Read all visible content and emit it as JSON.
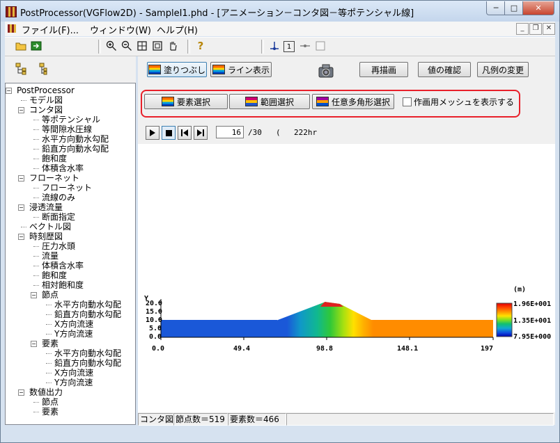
{
  "window": {
    "title": "PostProcessor(VGFlow2D) - SampleI1.phd - [アニメーション－コンタ図－等ポテンシャル線]",
    "min_label": "─",
    "max_label": "□",
    "close_label": "✕"
  },
  "menu": {
    "file": "ファイル(F)...",
    "window": "ウィンドウ(W)",
    "help": "ヘルプ(H)",
    "mdi_min": "_",
    "mdi_restore": "❐",
    "mdi_close": "✕"
  },
  "toolbar": {
    "frame_value": "1"
  },
  "view_tabs": {
    "fill": "塗りつぶし",
    "line": "ライン表示"
  },
  "actions": {
    "redraw": "再描画",
    "check_value": "値の確認",
    "change_legend": "凡例の変更"
  },
  "selection": {
    "element": "要素選択",
    "range": "範囲選択",
    "polygon": "任意多角形選択",
    "show_mesh": "作画用メッシュを表示する"
  },
  "animation": {
    "current_frame": "16",
    "total_frames": "/30",
    "time_open": "(",
    "time_value": "222hr"
  },
  "tree": [
    {
      "label": "PostProcessor",
      "level": 0,
      "toggle": "−"
    },
    {
      "label": "モデル図",
      "level": 1
    },
    {
      "label": "コンタ図",
      "level": 1,
      "toggle": "−"
    },
    {
      "label": "等ポテンシャル",
      "level": 2
    },
    {
      "label": "等間隙水圧線",
      "level": 2
    },
    {
      "label": "水平方向動水勾配",
      "level": 2
    },
    {
      "label": "鉛直方向動水勾配",
      "level": 2
    },
    {
      "label": "飽和度",
      "level": 2
    },
    {
      "label": "体積含水率",
      "level": 2
    },
    {
      "label": "フローネット",
      "level": 1,
      "toggle": "−"
    },
    {
      "label": "フローネット",
      "level": 2
    },
    {
      "label": "流線のみ",
      "level": 2
    },
    {
      "label": "浸透流量",
      "level": 1,
      "toggle": "−"
    },
    {
      "label": "断面指定",
      "level": 2
    },
    {
      "label": "ベクトル図",
      "level": 1
    },
    {
      "label": "時刻歴図",
      "level": 1,
      "toggle": "−"
    },
    {
      "label": "圧力水頭",
      "level": 2
    },
    {
      "label": "流量",
      "level": 2
    },
    {
      "label": "体積含水率",
      "level": 2
    },
    {
      "label": "飽和度",
      "level": 2
    },
    {
      "label": "相対飽和度",
      "level": 2
    },
    {
      "label": "節点",
      "level": 2,
      "toggle": "−"
    },
    {
      "label": "水平方向動水勾配",
      "level": 3
    },
    {
      "label": "鉛直方向動水勾配",
      "level": 3
    },
    {
      "label": "X方向流速",
      "level": 3
    },
    {
      "label": "Y方向流速",
      "level": 3
    },
    {
      "label": "要素",
      "level": 2,
      "toggle": "−"
    },
    {
      "label": "水平方向動水勾配",
      "level": 3
    },
    {
      "label": "鉛直方向動水勾配",
      "level": 3
    },
    {
      "label": "X方向流速",
      "level": 3
    },
    {
      "label": "Y方向流速",
      "level": 3
    },
    {
      "label": "数値出力",
      "level": 1,
      "toggle": "−"
    },
    {
      "label": "節点",
      "level": 2
    },
    {
      "label": "要素",
      "level": 2
    }
  ],
  "plot": {
    "y_axis_label": "Y",
    "y_ticks": [
      "20.0",
      "15.0",
      "10.0",
      "5.0",
      "0.0"
    ],
    "x_ticks": [
      "0.0",
      "49.4",
      "98.8",
      "148.1",
      "197"
    ],
    "legend_unit": "(m)",
    "legend_max": "1.96E+001",
    "legend_mid": "1.35E+001",
    "legend_min": "7.95E+000",
    "colors": {
      "upstream": "#1560d8",
      "downstream": "#ff8c00"
    }
  },
  "status": {
    "mode": "コンタ図",
    "nodes": "節点数＝519",
    "elements": "要素数＝466"
  }
}
